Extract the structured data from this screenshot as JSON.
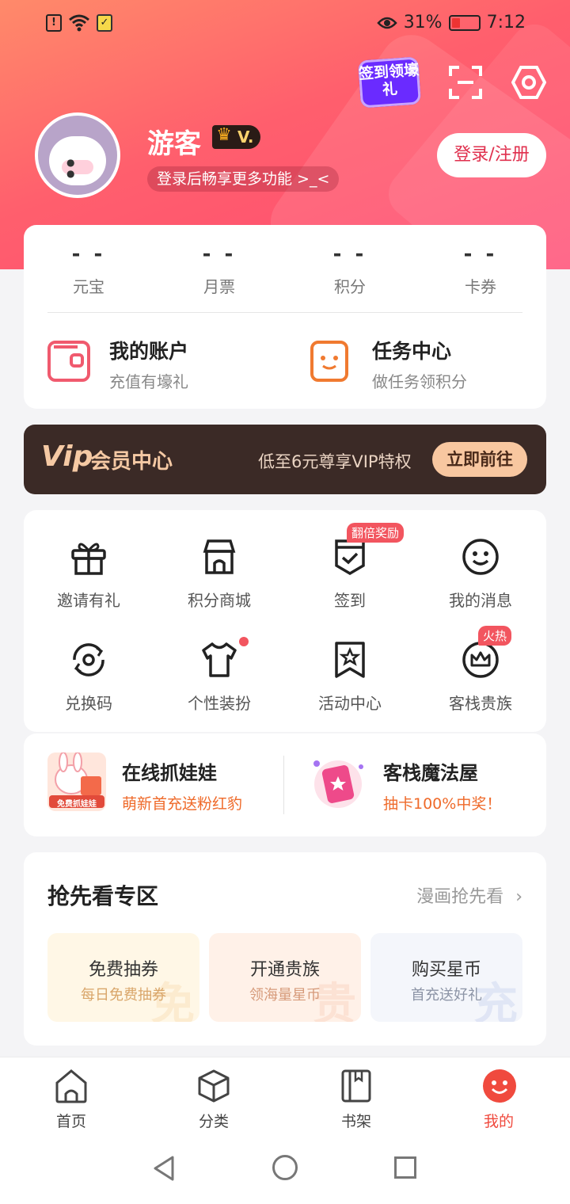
{
  "status_bar": {
    "battery_percent": "31%",
    "time": "7:12"
  },
  "header": {
    "signin_badge_text": "签到领壕礼",
    "username": "游客",
    "level_badge": "V.",
    "subtitle": "登录后畅享更多功能 >_<",
    "login_button": "登录/注册"
  },
  "stats": [
    {
      "value": "- -",
      "label": "元宝"
    },
    {
      "value": "- -",
      "label": "月票"
    },
    {
      "value": "- -",
      "label": "积分"
    },
    {
      "value": "- -",
      "label": "卡券"
    }
  ],
  "quick_links": [
    {
      "title": "我的账户",
      "subtitle": "充值有壕礼",
      "icon": "wallet-icon"
    },
    {
      "title": "任务中心",
      "subtitle": "做任务领积分",
      "icon": "task-clipboard-icon"
    }
  ],
  "vip": {
    "logo": "Vip",
    "title": "会员中心",
    "desc": "低至6元尊享VIP特权",
    "button": "立即前往",
    "colors": {
      "bg": "#3b2a26",
      "accent": "#f5c9a4"
    }
  },
  "grid": [
    {
      "label": "邀请有礼",
      "icon": "gift-icon"
    },
    {
      "label": "积分商城",
      "icon": "store-icon"
    },
    {
      "label": "签到",
      "icon": "checkin-icon",
      "tag": "翻倍奖励"
    },
    {
      "label": "我的消息",
      "icon": "smiley-message-icon"
    },
    {
      "label": "兑换码",
      "icon": "redeem-code-icon"
    },
    {
      "label": "个性装扮",
      "icon": "shirt-icon",
      "dot": true
    },
    {
      "label": "活动中心",
      "icon": "star-bookmark-icon"
    },
    {
      "label": "客栈贵族",
      "icon": "crown-circle-icon",
      "tag": "火热"
    }
  ],
  "promos": [
    {
      "title": "在线抓娃娃",
      "subtitle": "萌新首充送粉红豹",
      "image_text": "免费抓娃娃"
    },
    {
      "title": "客栈魔法屋",
      "subtitle": "抽卡100%中奖！"
    }
  ],
  "early_access": {
    "title": "抢先看专区",
    "more": "漫画抢先看",
    "tiles": [
      {
        "title": "免费抽券",
        "subtitle": "每日免费抽券",
        "watermark": "免",
        "bg": "#fff7e6",
        "sub_color": "#d9a66a"
      },
      {
        "title": "开通贵族",
        "subtitle": "领海量星币",
        "watermark": "贵",
        "bg": "#fff1e8",
        "sub_color": "#d69a7a"
      },
      {
        "title": "购买星币",
        "subtitle": "首充送好礼",
        "watermark": "充",
        "bg": "#f4f6fb",
        "sub_color": "#8c94a6"
      }
    ]
  },
  "tabs": [
    {
      "label": "首页",
      "icon": "home-icon"
    },
    {
      "label": "分类",
      "icon": "cube-icon"
    },
    {
      "label": "书架",
      "icon": "bookshelf-icon"
    },
    {
      "label": "我的",
      "icon": "profile-smile-icon",
      "active": true
    }
  ],
  "accent_color": "#f04a3e"
}
